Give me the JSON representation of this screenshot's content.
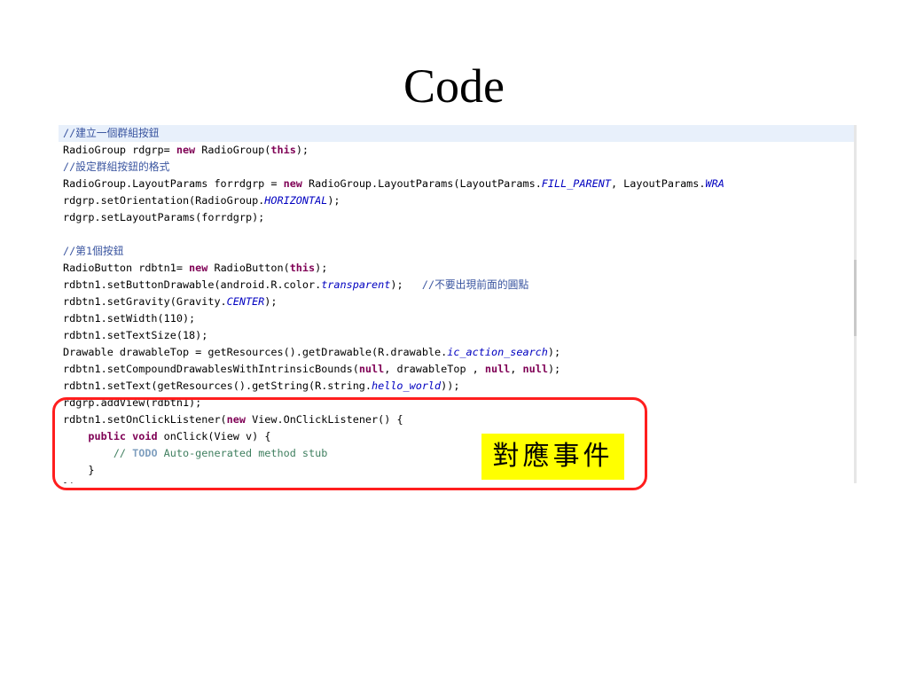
{
  "slide": {
    "title": "Code",
    "callout": {
      "label": "對應事件",
      "frame_color": "#ff1e1e",
      "label_bg": "#ffff00"
    }
  },
  "code": {
    "highlight_color": "#e8f0fb",
    "lines": [
      [
        {
          "t": "//建立一個群組按鈕",
          "c": "cj"
        }
      ],
      [
        {
          "t": "RadioGroup rdgrp= "
        },
        {
          "t": "new",
          "c": "k"
        },
        {
          "t": " RadioGroup("
        },
        {
          "t": "this",
          "c": "k"
        },
        {
          "t": ");"
        }
      ],
      [
        {
          "t": "//設定群組按鈕的格式",
          "c": "cj"
        }
      ],
      [
        {
          "t": "RadioGroup.LayoutParams forrdgrp = "
        },
        {
          "t": "new",
          "c": "k"
        },
        {
          "t": " RadioGroup.LayoutParams(LayoutParams."
        },
        {
          "t": "FILL_PARENT",
          "c": "f"
        },
        {
          "t": ", LayoutParams."
        },
        {
          "t": "WRA",
          "c": "f"
        }
      ],
      [
        {
          "t": "rdgrp.setOrientation(RadioGroup."
        },
        {
          "t": "HORIZONTAL",
          "c": "f"
        },
        {
          "t": ");"
        }
      ],
      [
        {
          "t": "rdgrp.setLayoutParams(forrdgrp);"
        }
      ],
      [],
      [
        {
          "t": "//第1個按鈕",
          "c": "cj"
        }
      ],
      [
        {
          "t": "RadioButton rdbtn1= "
        },
        {
          "t": "new",
          "c": "k"
        },
        {
          "t": " RadioButton("
        },
        {
          "t": "this",
          "c": "k"
        },
        {
          "t": ");"
        }
      ],
      [
        {
          "t": "rdbtn1.setButtonDrawable(android.R.color."
        },
        {
          "t": "transparent",
          "c": "f"
        },
        {
          "t": ");   "
        },
        {
          "t": "//不要出現前面的圓點",
          "c": "cj"
        }
      ],
      [
        {
          "t": "rdbtn1.setGravity(Gravity."
        },
        {
          "t": "CENTER",
          "c": "f"
        },
        {
          "t": ");"
        }
      ],
      [
        {
          "t": "rdbtn1.setWidth(110);"
        }
      ],
      [
        {
          "t": "rdbtn1.setTextSize(18);"
        }
      ],
      [
        {
          "t": "Drawable drawableTop = getResources().getDrawable(R.drawable."
        },
        {
          "t": "ic_action_search",
          "c": "f"
        },
        {
          "t": ");"
        }
      ],
      [
        {
          "t": "rdbtn1.setCompoundDrawablesWithIntrinsicBounds("
        },
        {
          "t": "null",
          "c": "k"
        },
        {
          "t": ", drawableTop , "
        },
        {
          "t": "null",
          "c": "k"
        },
        {
          "t": ", "
        },
        {
          "t": "null",
          "c": "k"
        },
        {
          "t": ");"
        }
      ],
      [
        {
          "t": "rdbtn1.setText(getResources().getString(R.string."
        },
        {
          "t": "hello_world",
          "c": "f"
        },
        {
          "t": "));"
        }
      ],
      [
        {
          "t": "rdgrp.addView(rdbtn1);"
        }
      ],
      [
        {
          "t": "rdbtn1.setOnClickListener("
        },
        {
          "t": "new",
          "c": "k"
        },
        {
          "t": " View.OnClickListener() {"
        }
      ],
      [
        {
          "t": "    "
        },
        {
          "t": "public",
          "c": "k"
        },
        {
          "t": " "
        },
        {
          "t": "void",
          "c": "k"
        },
        {
          "t": " onClick(View v) {"
        }
      ],
      [
        {
          "t": "        "
        },
        {
          "t": "// ",
          "c": "c"
        },
        {
          "t": "TODO",
          "c": "t"
        },
        {
          "t": " Auto-generated method stub",
          "c": "c"
        }
      ],
      [
        {
          "t": "    }"
        }
      ],
      [
        {
          "t": "});"
        }
      ]
    ]
  }
}
